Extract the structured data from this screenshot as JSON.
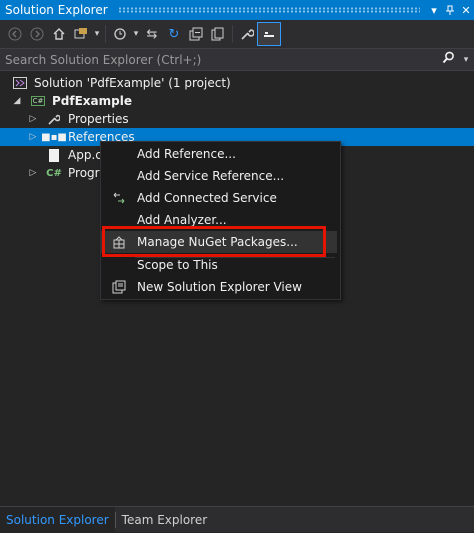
{
  "window": {
    "title": "Solution Explorer"
  },
  "toolbar": {
    "icons": [
      "back-icon",
      "forward-icon",
      "home-icon",
      "switch-views-icon",
      "dropdown-icon",
      "history-icon",
      "dropdown-icon",
      "sync-icon",
      "refresh-icon",
      "collapse-all-icon",
      "show-all-files-icon",
      "properties-icon",
      "preview-icon"
    ]
  },
  "search": {
    "placeholder": "Search Solution Explorer (Ctrl+;)"
  },
  "tree": {
    "solution": "Solution 'PdfExample' (1 project)",
    "project": "PdfExample",
    "properties": "Properties",
    "references": "References",
    "app_config": "App.c",
    "program": "Progra"
  },
  "context_menu": {
    "items": [
      {
        "label": "Add Reference...",
        "icon": ""
      },
      {
        "label": "Add Service Reference...",
        "icon": ""
      },
      {
        "label": "Add Connected Service",
        "icon": "connected-service-icon"
      },
      {
        "label": "Add Analyzer...",
        "icon": ""
      },
      {
        "label": "Manage NuGet Packages...",
        "icon": "nuget-icon",
        "highlighted": true
      },
      {
        "label": "Scope to This",
        "icon": ""
      },
      {
        "label": "New Solution Explorer View",
        "icon": "new-view-icon"
      }
    ]
  },
  "bottom_tabs": [
    {
      "label": "Solution Explorer",
      "active": true
    },
    {
      "label": "Team Explorer",
      "active": false
    }
  ],
  "colors": {
    "accent": "#007acc",
    "highlight_box": "#e51400",
    "background": "#252526",
    "menu_background": "#1b1b1c"
  }
}
